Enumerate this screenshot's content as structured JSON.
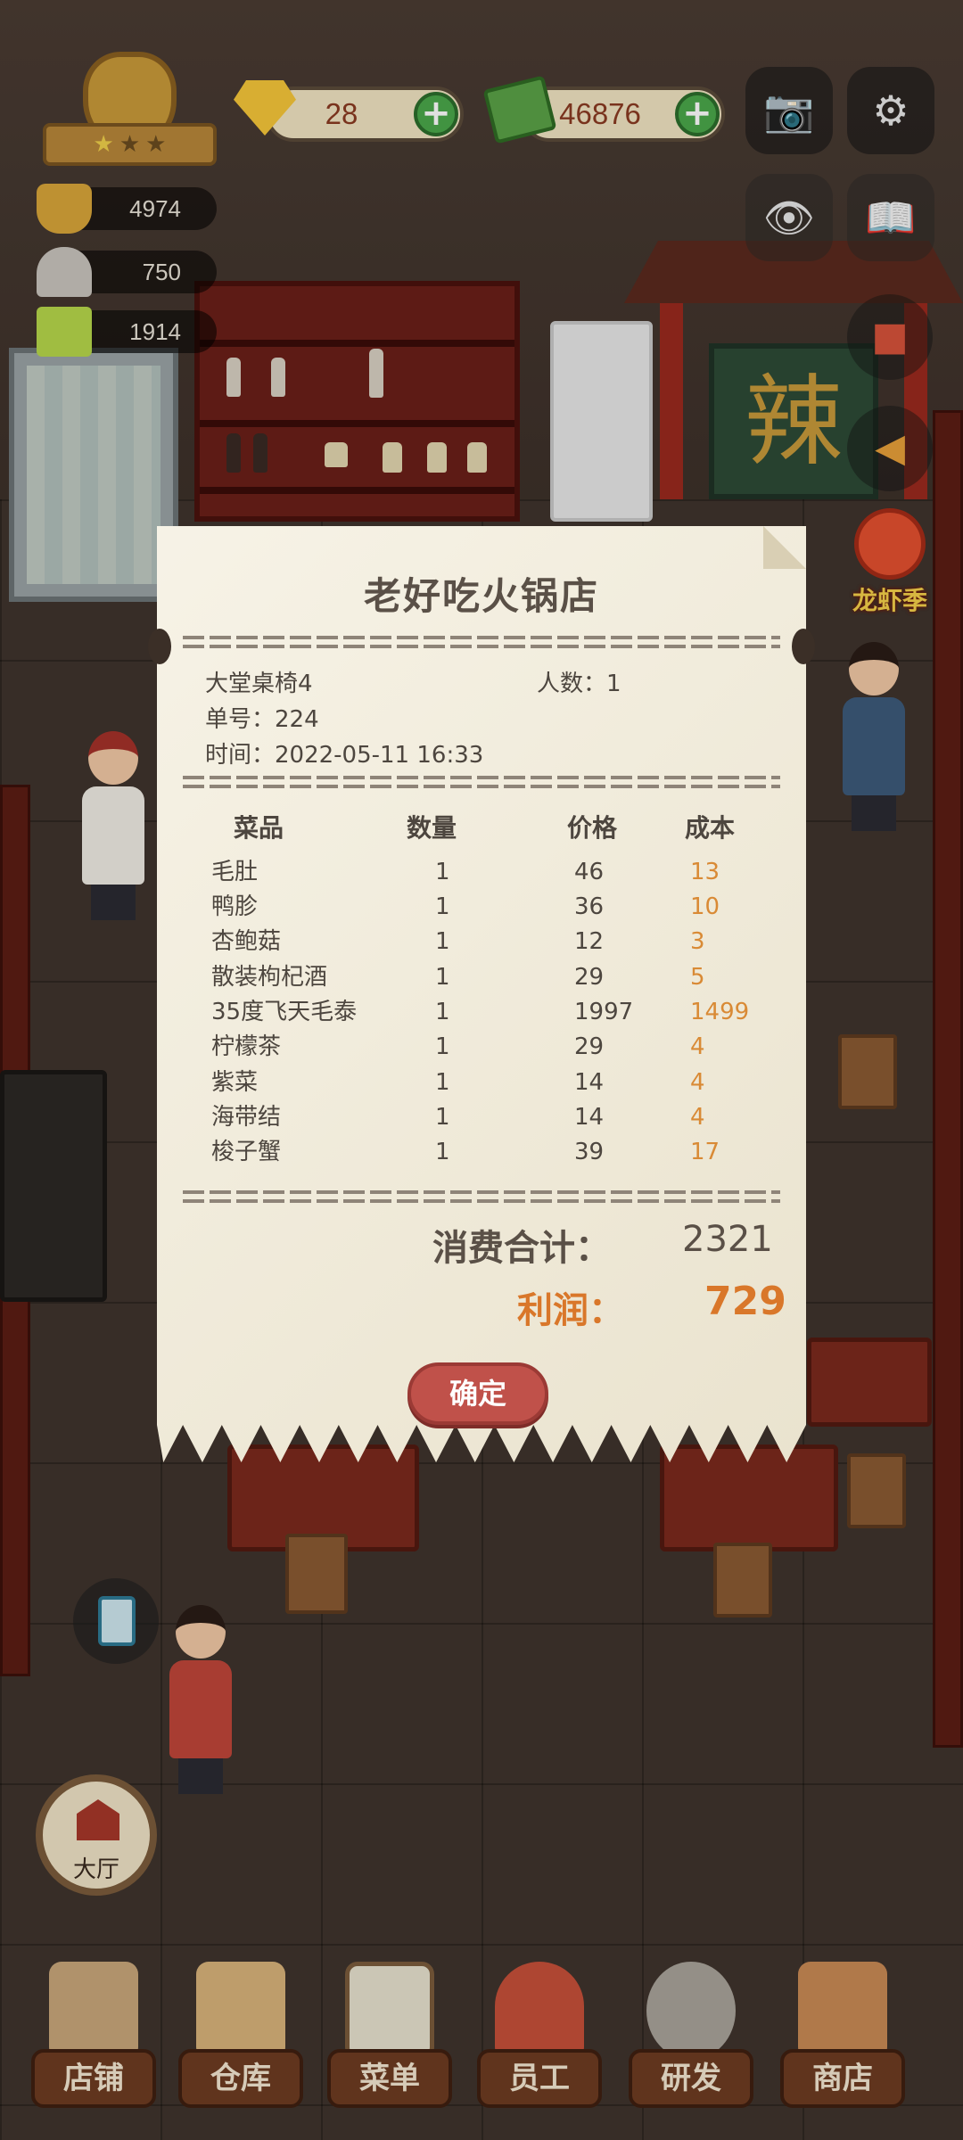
{
  "hud": {
    "gems": "28",
    "cash": "46876",
    "stats": [
      {
        "icon": "hotpot-icon",
        "value": "4974"
      },
      {
        "icon": "cloche-icon",
        "value": "750"
      },
      {
        "icon": "cash-stack-icon",
        "value": "1914"
      }
    ],
    "event_label": "龙虾季",
    "hall_label": "大厅",
    "sign_text": "辣"
  },
  "receipt": {
    "title": "老好吃火锅店",
    "table": "大堂桌椅4",
    "guests_label": "人数：1",
    "order_label": "单号：224",
    "time_label": "时间：2022-05-11 16:33",
    "headers": {
      "item": "菜品",
      "qty": "数量",
      "price": "价格",
      "cost": "成本"
    },
    "items": [
      {
        "name": "毛肚",
        "qty": "1",
        "price": "46",
        "cost": "13"
      },
      {
        "name": "鸭胗",
        "qty": "1",
        "price": "36",
        "cost": "10"
      },
      {
        "name": "杏鲍菇",
        "qty": "1",
        "price": "12",
        "cost": "3"
      },
      {
        "name": "散装枸杞酒",
        "qty": "1",
        "price": "29",
        "cost": "5"
      },
      {
        "name": "35度飞天毛泰",
        "qty": "1",
        "price": "1997",
        "cost": "1499"
      },
      {
        "name": "柠檬茶",
        "qty": "1",
        "price": "29",
        "cost": "4"
      },
      {
        "name": "紫菜",
        "qty": "1",
        "price": "14",
        "cost": "4"
      },
      {
        "name": "海带结",
        "qty": "1",
        "price": "14",
        "cost": "4"
      },
      {
        "name": "梭子蟹",
        "qty": "1",
        "price": "39",
        "cost": "17"
      }
    ],
    "total_label": "消费合计：",
    "total_value": "2321",
    "profit_label": "利润：",
    "profit_value": "729",
    "confirm": "确定"
  },
  "nav": [
    {
      "label": "店铺",
      "icon": "shop-front-icon",
      "color": "#c9a77a"
    },
    {
      "label": "仓库",
      "icon": "boxes-icon",
      "color": "#d9b37a"
    },
    {
      "label": "菜单",
      "icon": "clipboard-menu-icon",
      "color": "#e7e2cf"
    },
    {
      "label": "员工",
      "icon": "chef-staff-icon",
      "color": "#c7503a"
    },
    {
      "label": "研发",
      "icon": "wok-icon",
      "color": "#a9a39a"
    },
    {
      "label": "商店",
      "icon": "store-icon",
      "color": "#c98a55"
    }
  ],
  "colors": {
    "receipt_bg": "#f2ecd9",
    "cost_orange": "#d98a35",
    "profit_orange": "#d9772a",
    "confirm_red": "#c0514a",
    "nav_label_bg": "#6e3c22"
  }
}
